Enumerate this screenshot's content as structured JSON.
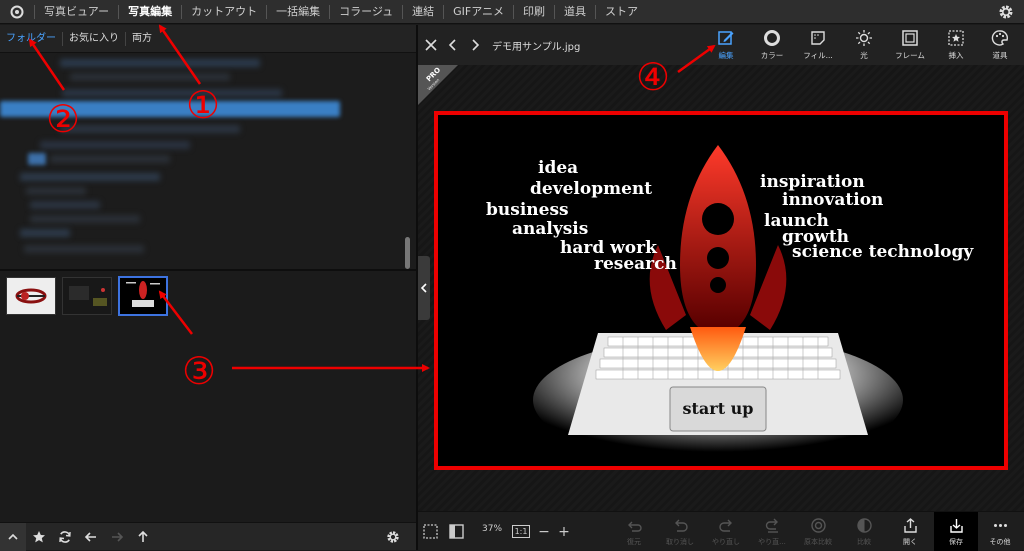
{
  "menu": {
    "items": [
      "写真ビュアー",
      "写真編集",
      "カットアウト",
      "一括編集",
      "コラージュ",
      "連結",
      "GIFアニメ",
      "印刷",
      "道具",
      "ストア"
    ],
    "active_index": 1
  },
  "left_panel": {
    "tabs": [
      "フォルダー",
      "お気に入り",
      "両方"
    ],
    "active_tab": 0
  },
  "viewer": {
    "filename": "デモ用サンプル.jpg",
    "ribbon_text": "PRO",
    "ribbon_sub": "Version",
    "tools": [
      {
        "label": "編集",
        "icon": "edit-icon"
      },
      {
        "label": "カラー",
        "icon": "color-icon"
      },
      {
        "label": "フィル...",
        "icon": "filter-icon"
      },
      {
        "label": "光",
        "icon": "light-icon"
      },
      {
        "label": "フレーム",
        "icon": "frame-icon"
      },
      {
        "label": "挿入",
        "icon": "insert-icon"
      },
      {
        "label": "道具",
        "icon": "tools-icon"
      }
    ],
    "active_tool": 0,
    "zoom": "37%",
    "ratio_label": "1:1",
    "minus_label": "−",
    "plus_label": "+",
    "bottom_buttons": [
      {
        "label": "復元",
        "icon": "restore-icon",
        "enabled": false
      },
      {
        "label": "取り消し",
        "icon": "undo-icon",
        "enabled": false
      },
      {
        "label": "やり直し",
        "icon": "redo-icon",
        "enabled": false
      },
      {
        "label": "やり直...",
        "icon": "redo-all-icon",
        "enabled": false
      },
      {
        "label": "原本比較",
        "icon": "compare-original-icon",
        "enabled": false
      },
      {
        "label": "比較",
        "icon": "compare-icon",
        "enabled": false
      },
      {
        "label": "開く",
        "icon": "open-icon",
        "enabled": true
      },
      {
        "label": "保存",
        "icon": "save-icon",
        "enabled": true
      },
      {
        "label": "その他",
        "icon": "more-icon",
        "enabled": true
      }
    ]
  },
  "photo": {
    "words_left": [
      "idea",
      "development",
      "business",
      "analysis",
      "hard work",
      "research"
    ],
    "words_right": [
      "inspiration",
      "innovation",
      "launch",
      "growth",
      "science technology"
    ],
    "key_label": "start up"
  },
  "annotations": {
    "markers": [
      "①",
      "②",
      "③",
      "④"
    ],
    "color": "#e00000"
  },
  "colors": {
    "accent": "#4aa3ff",
    "selection": "#3d73e0",
    "highlight_box": "#e00000"
  }
}
